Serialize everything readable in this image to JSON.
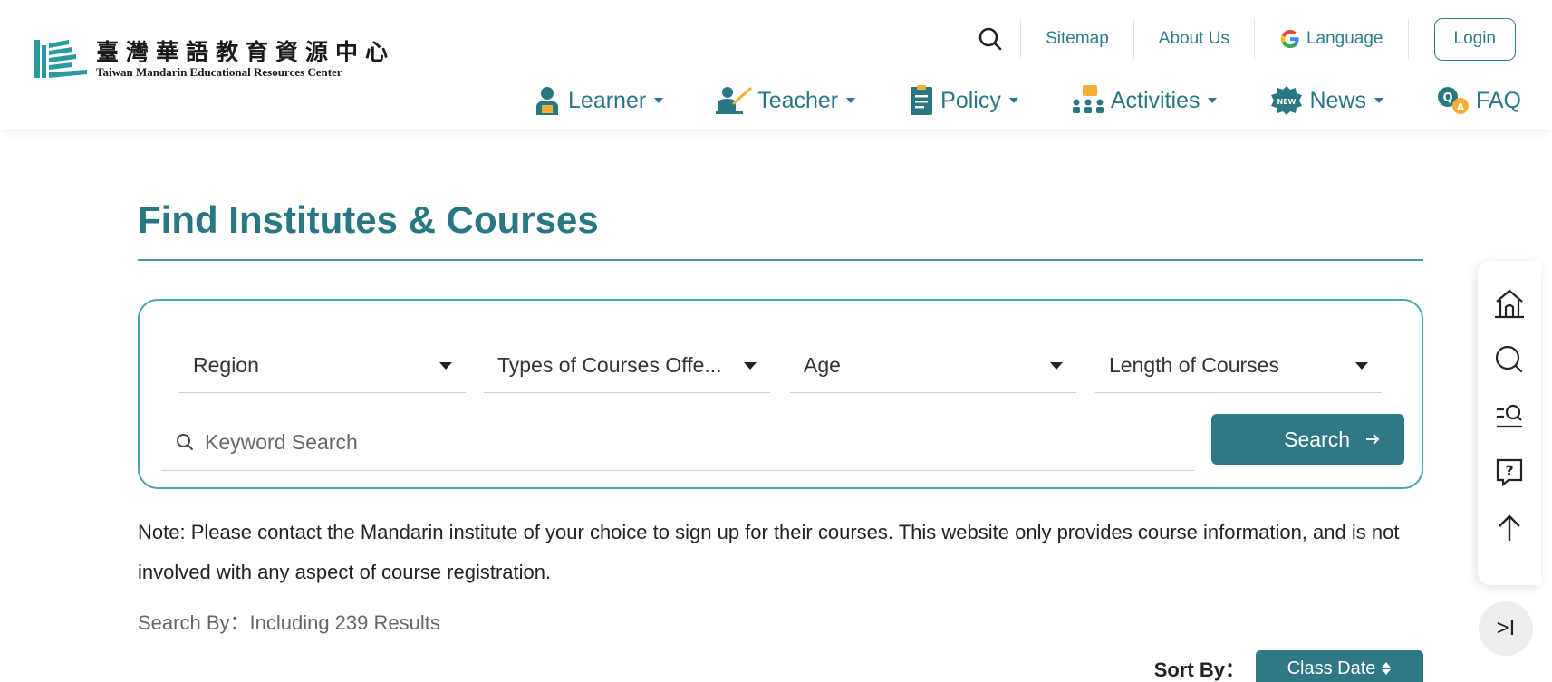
{
  "header": {
    "logo": {
      "title_zh": "臺灣華語教育資源中心",
      "title_en": "Taiwan Mandarin Educational Resources Center"
    },
    "utility": {
      "search_icon": "search-icon",
      "links": [
        "Sitemap",
        "About Us"
      ],
      "language_label": "Language",
      "login_label": "Login"
    },
    "nav": [
      {
        "label": "Learner",
        "icon": "learner-icon"
      },
      {
        "label": "Teacher",
        "icon": "teacher-icon"
      },
      {
        "label": "Policy",
        "icon": "policy-icon"
      },
      {
        "label": "Activities",
        "icon": "activities-icon"
      },
      {
        "label": "News",
        "icon": "news-icon"
      },
      {
        "label": "FAQ",
        "icon": "faq-icon"
      }
    ]
  },
  "main": {
    "title": "Find Institutes & Courses",
    "filters": {
      "region": "Region",
      "course_types": "Types of Courses Offe...",
      "age": "Age",
      "length": "Length of Courses"
    },
    "keyword_placeholder": "Keyword Search",
    "search_label": "Search",
    "note": "Note: Please contact the Mandarin institute of your choice to sign up for their courses. This website only provides course information, and is not involved with any aspect of course registration.",
    "search_by_label": "Search By：",
    "results_text": "Including 239 Results",
    "sort_by_label": "Sort By：",
    "sort_value": "Class Date"
  },
  "side_toolbar": {
    "buttons": [
      "home-icon",
      "search-icon",
      "advanced-search-icon",
      "question-icon",
      "arrow-up-icon"
    ],
    "collapse_label": ">I"
  },
  "colors": {
    "teal": "#2f7886",
    "teal_light": "#4aa5ab",
    "link": "#2f7e8b"
  }
}
